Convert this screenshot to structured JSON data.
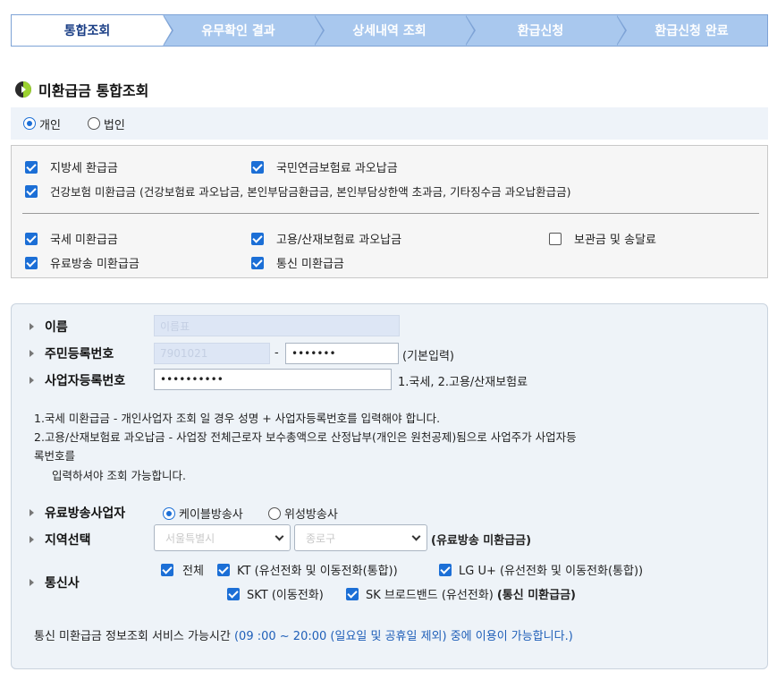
{
  "steps": [
    {
      "label": "통합조회",
      "active": true
    },
    {
      "label": "유무확인 결과",
      "active": false
    },
    {
      "label": "상세내역 조회",
      "active": false
    },
    {
      "label": "환급신청",
      "active": false
    },
    {
      "label": "환급신청 완료",
      "active": false
    }
  ],
  "section_title": "미환급금 통합조회",
  "type_options": {
    "personal": "개인",
    "corporate": "법인",
    "selected": "personal"
  },
  "checks": {
    "local_tax": {
      "label": "지방세 환급금",
      "checked": true
    },
    "pension": {
      "label": "국민연금보험료 과오납금",
      "checked": true
    },
    "health": {
      "label": "건강보험 미환급금 (건강보험료 과오납금, 본인부담금환급금, 본인부담상한액 초과금, 기타징수금 과오납환급금)",
      "checked": true
    },
    "national_tax": {
      "label": "국세 미환급금",
      "checked": true
    },
    "employment": {
      "label": "고용/산재보험료 과오납금",
      "checked": true
    },
    "deposit": {
      "label": "보관금 및 송달료",
      "checked": false
    },
    "cable": {
      "label": "유료방송 미환급금",
      "checked": true
    },
    "telecom": {
      "label": "통신 미환급금",
      "checked": true
    }
  },
  "form": {
    "name_label": "이름",
    "name_value": "이름표",
    "rrn_label": "주민등록번호",
    "rrn_front": "7901021",
    "rrn_dash": "-",
    "rrn_back": "•••••••",
    "rrn_note": "(기본입력)",
    "biz_label": "사업자등록번호",
    "biz_value": "••••••••••",
    "biz_note": "1.국세, 2.고용/산재보험료",
    "notice1": "1.국세 미환급금 - 개인사업자 조회 일 경우 성명 + 사업자등록번호를 입력해야 합니다.",
    "notice2a": "2.고용/산재보험료 과오납금 - 사업장 전체근로자 보수총액으로 산정납부(개인은 원천공제)됨으로 사업주가 사업자등",
    "notice2b": "록번호를",
    "notice2c": "입력하셔야 조회 가능합니다.",
    "cable_label": "유료방송사업자",
    "cable_opt1": "케이블방송사",
    "cable_opt2": "위성방송사",
    "cable_selected": "케이블방송사",
    "region_label": "지역선택",
    "region_sel1": "서울특별시",
    "region_sel2": "종로구",
    "region_note": "(유료방송 미환급금)",
    "telecom_label": "통신사",
    "tel_all": {
      "label": "전체",
      "checked": true
    },
    "tel_kt": {
      "label": "KT (유선전화 및 이동전화(통합))",
      "checked": true
    },
    "tel_lg": {
      "label": "LG U+ (유선전화 및 이동전화(통합))",
      "checked": true
    },
    "tel_skt": {
      "label": "SKT (이동전화)",
      "checked": true
    },
    "tel_skb": {
      "label": "SK 브로드밴드 (유선전화)",
      "checked": true
    },
    "tel_note": "(통신 미환급금)",
    "service_prefix": "통신 미환급금 정보조회 서비스 가능시간 ",
    "service_hours": "(09 :00 ~ 20:00 (일요일 및 공휴일 제외) 중에 이용이 가능합니다.)"
  },
  "colors": {
    "accent": "#1c6fd6",
    "step_bg": "#a9c8ee",
    "step_active_text": "#1b3f86",
    "link_blue": "#1f5fb8"
  }
}
